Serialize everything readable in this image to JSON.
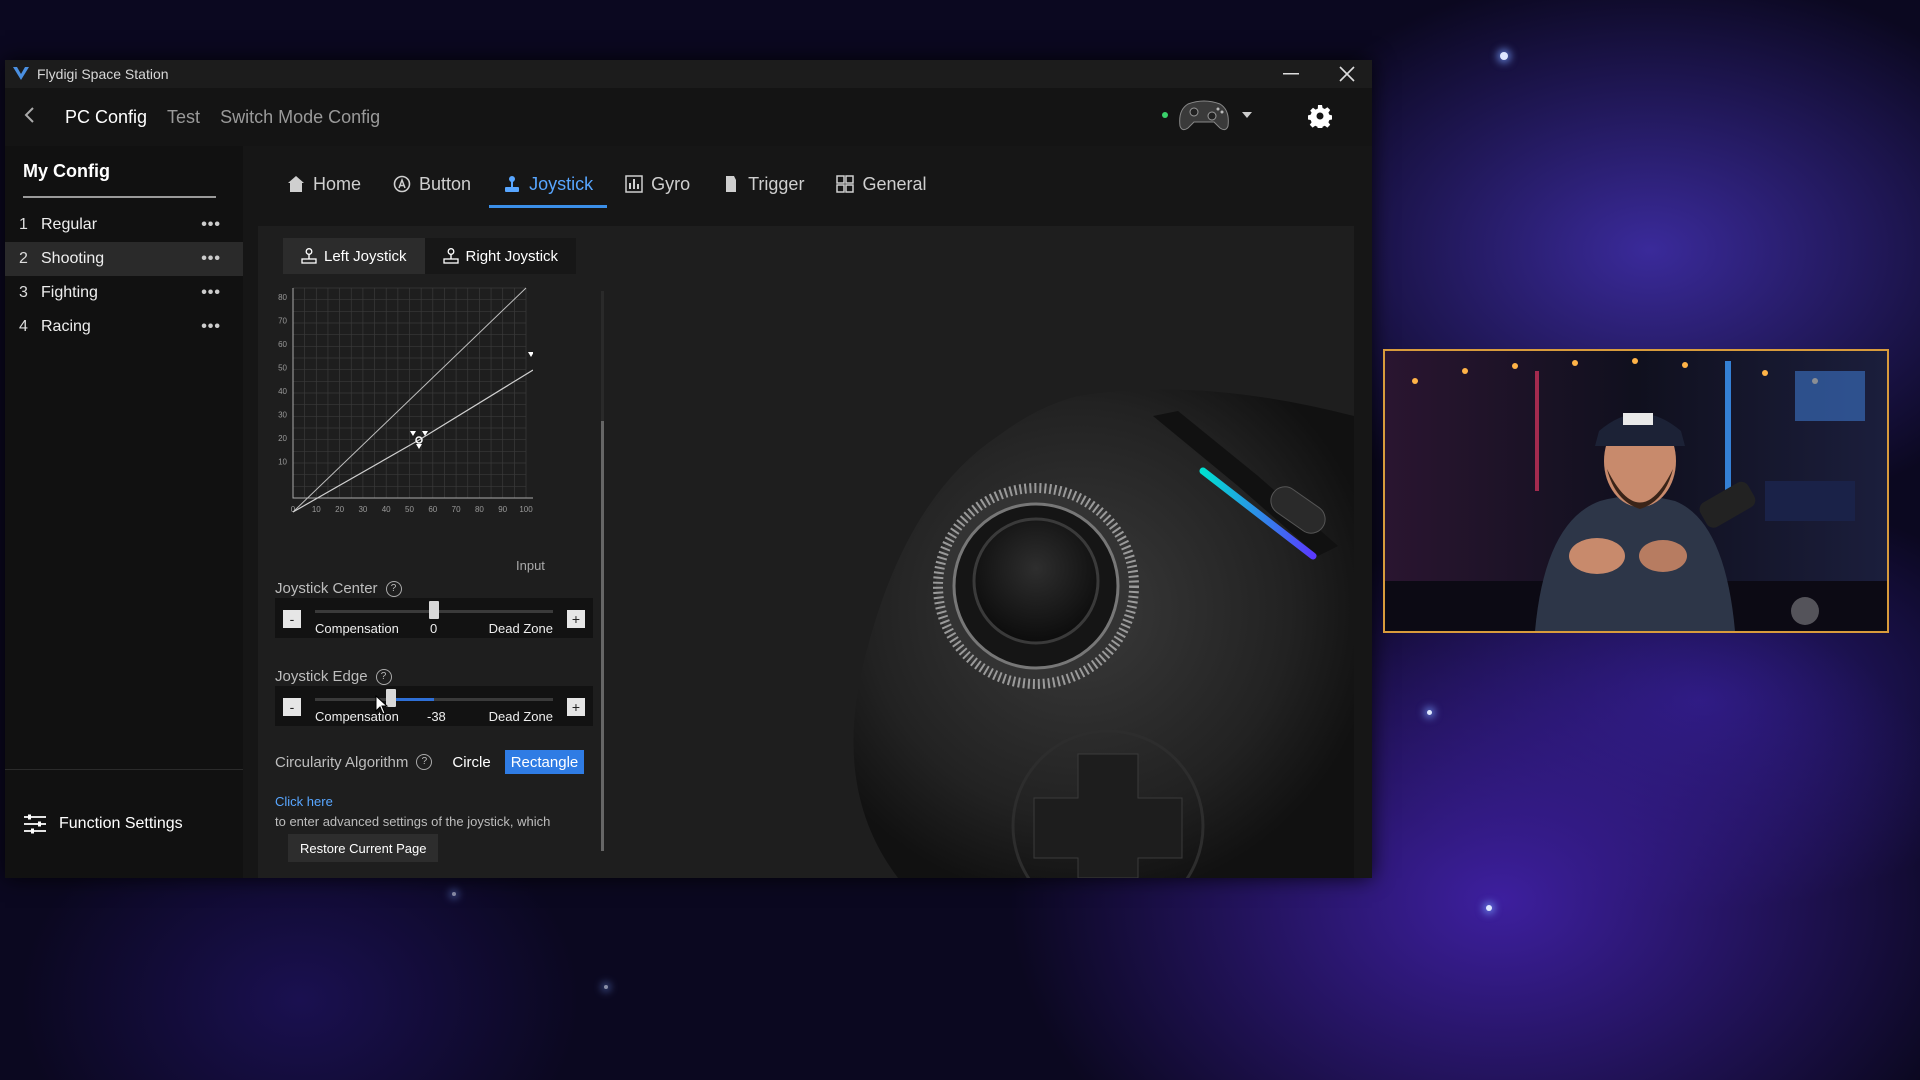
{
  "window": {
    "title": "Flydigi Space Station"
  },
  "nav": {
    "back_icon": "chevron-left-icon",
    "links": [
      "PC Config",
      "Test",
      "Switch Mode Config"
    ],
    "active": "PC Config"
  },
  "sidebar": {
    "header": "My Config",
    "items": [
      {
        "num": "1",
        "label": "Regular"
      },
      {
        "num": "2",
        "label": "Shooting"
      },
      {
        "num": "3",
        "label": "Fighting"
      },
      {
        "num": "4",
        "label": "Racing"
      }
    ],
    "more_label": "•••",
    "selected": "Shooting",
    "function_settings": "Function Settings"
  },
  "tabs": [
    "Home",
    "Button",
    "Joystick",
    "Gyro",
    "Trigger",
    "General"
  ],
  "active_tab": "Joystick",
  "subtabs": [
    "Left Joystick",
    "Right Joystick"
  ],
  "active_subtab": "Left Joystick",
  "graph": {
    "y_ticks": [
      "80",
      "70",
      "60",
      "50",
      "40",
      "30",
      "20",
      "10"
    ],
    "x_ticks": [
      "0",
      "10",
      "20",
      "30",
      "40",
      "50",
      "60",
      "70",
      "80",
      "90",
      "100"
    ],
    "x_label": "Input"
  },
  "joystick_center": {
    "label": "Joystick Center",
    "minus": "-",
    "plus": "+",
    "left_label": "Compensation",
    "right_label": "Dead Zone",
    "value": "0",
    "level": 0.5
  },
  "joystick_edge": {
    "label": "Joystick Edge",
    "minus": "-",
    "plus": "+",
    "left_label": "Compensation",
    "right_label": "Dead Zone",
    "value": "-38",
    "level": 0.32
  },
  "circularity": {
    "label": "Circularity Algorithm",
    "options": [
      "Circle",
      "Rectangle"
    ],
    "selected": "Rectangle"
  },
  "advanced": {
    "link": "Click here",
    "hint": "to enter advanced settings of the joystick, which"
  },
  "restore_label": "Restore Current Page",
  "colors": {
    "accent": "#3b8fe8",
    "status_dot": "#3ad16b",
    "webcam_border": "#d89b3c"
  }
}
